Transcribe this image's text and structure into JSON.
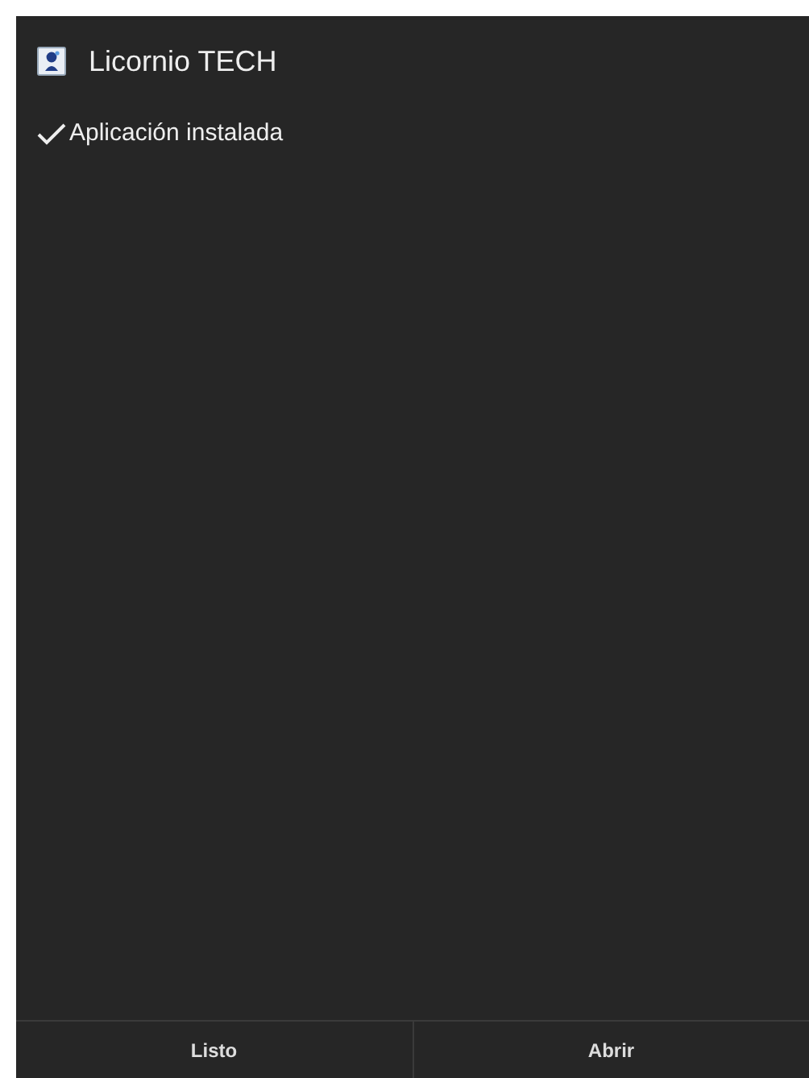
{
  "window": {
    "title": "Licornio TECH"
  },
  "status": {
    "text": "Aplicación instalada"
  },
  "buttons": [
    {
      "label": "Listo"
    },
    {
      "label": "Abrir"
    }
  ]
}
